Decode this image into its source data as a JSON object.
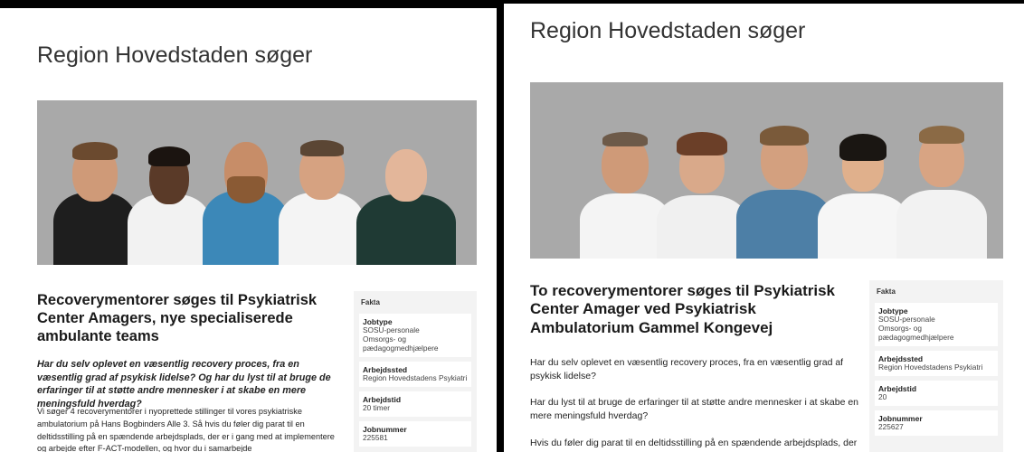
{
  "left": {
    "site_title": "Region Hovedstaden søger",
    "headline": "Recoverymentorer søges til Psykiatrisk Center Amagers, nye specialiserede ambulante teams",
    "intro_italic": "Har du selv oplevet en væsentlig recovery proces, fra en væsentlig grad af psykisk lidelse? Og har du lyst til at bruge de erfaringer til at støtte andre mennesker i at skabe en mere meningsfuld hverdag?",
    "body_text": "Vi søger 4 recoverymentorer i nyoprettede stillinger til vores psykiatriske ambulatorium på Hans Bogbinders Alle 3. Så hvis du føler dig parat til en deltidsstilling på en spændende arbejdsplads, der er i gang med at implementere og arbejde efter F-ACT-modellen, og hvor du i samarbejde",
    "facts": {
      "title": "Fakta",
      "items": [
        {
          "label": "Jobtype",
          "value": "SOSU-personale\nOmsorgs- og\npædagogmedhjælpere"
        },
        {
          "label": "Arbejdssted",
          "value": "Region Hovedstadens Psykiatri"
        },
        {
          "label": "Arbejdstid",
          "value": "20 timer"
        },
        {
          "label": "Jobnummer",
          "value": "225581"
        }
      ]
    }
  },
  "right": {
    "site_title": "Region Hovedstaden søger",
    "headline": "To recoverymentorer søges til Psykiatrisk Center Amager ved Psykiatrisk Ambulatorium Gammel Kongevej",
    "para1": "Har du selv oplevet en væsentlig recovery proces, fra en væsentlig grad af psykisk lidelse?",
    "para2": "Har du lyst til at bruge de erfaringer til at støtte andre mennesker i at skabe en mere meningsfuld hverdag?",
    "para3": "Hvis du føler dig parat til en deltidsstilling på en spændende arbejdsplads, der",
    "facts": {
      "title": "Fakta",
      "items": [
        {
          "label": "Jobtype",
          "value": "SOSU-personale\nOmsorgs- og\npædagogmedhjælpere"
        },
        {
          "label": "Arbejdssted",
          "value": "Region Hovedstadens Psykiatri"
        },
        {
          "label": "Arbejdstid",
          "value": "20"
        },
        {
          "label": "Jobnummer",
          "value": "225627"
        }
      ]
    }
  },
  "colors": {
    "hero_bg": "#a9a9a9",
    "facts_bg": "#f3f3f3",
    "separator": "#000000"
  }
}
